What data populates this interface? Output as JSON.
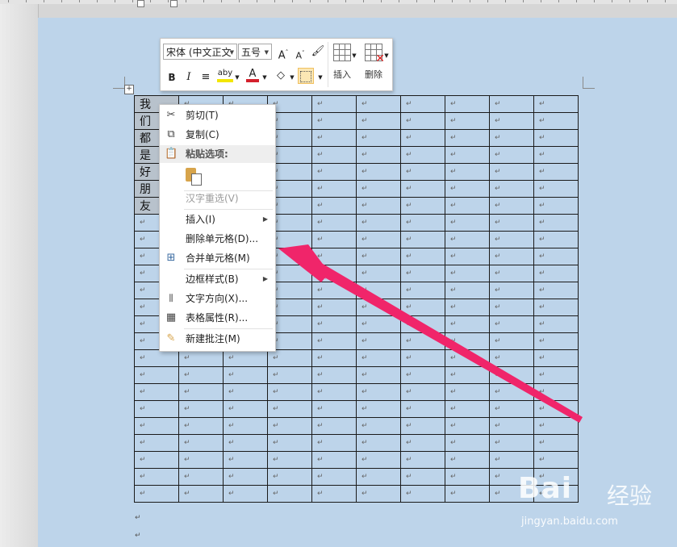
{
  "minibar": {
    "font_name": "宋体 (中文正文",
    "font_size": "五号",
    "grow_icon": "A",
    "shrink_icon": "A",
    "bold": "B",
    "italic": "I",
    "highlight_glyph": "aby",
    "font_color_glyph": "A",
    "insert_label": "插入",
    "delete_label": "删除",
    "highlight_color": "#f3e600",
    "font_color": "#d4202c"
  },
  "context_menu": {
    "items": [
      {
        "label": "剪切(T)",
        "icon": "scissors-icon"
      },
      {
        "label": "复制(C)",
        "icon": "copy-icon"
      },
      {
        "label": "粘贴选项:",
        "icon": "paste-icon"
      },
      {
        "label": "汉字重选(V)",
        "icon": ""
      },
      {
        "label": "插入(I)",
        "icon": ""
      },
      {
        "label": "删除单元格(D)...",
        "icon": ""
      },
      {
        "label": "合并单元格(M)",
        "icon": "merge-cells-icon"
      },
      {
        "label": "边框样式(B)",
        "icon": ""
      },
      {
        "label": "文字方向(X)...",
        "icon": "text-direction-icon"
      },
      {
        "label": "表格属性(R)...",
        "icon": "table-properties-icon"
      },
      {
        "label": "新建批注(M)",
        "icon": "new-comment-icon"
      }
    ]
  },
  "table": {
    "first_column_chars": [
      "我",
      "们",
      "都",
      "是",
      "好",
      "朋",
      "友"
    ],
    "paragraph_mark": "↵",
    "rows": 24,
    "cols": 10
  },
  "watermark": {
    "brand_text": "Bai",
    "brand_cn": "经验",
    "url": "jingyan.baidu.com"
  },
  "annotation": {
    "arrow_color": "#f0256a"
  }
}
